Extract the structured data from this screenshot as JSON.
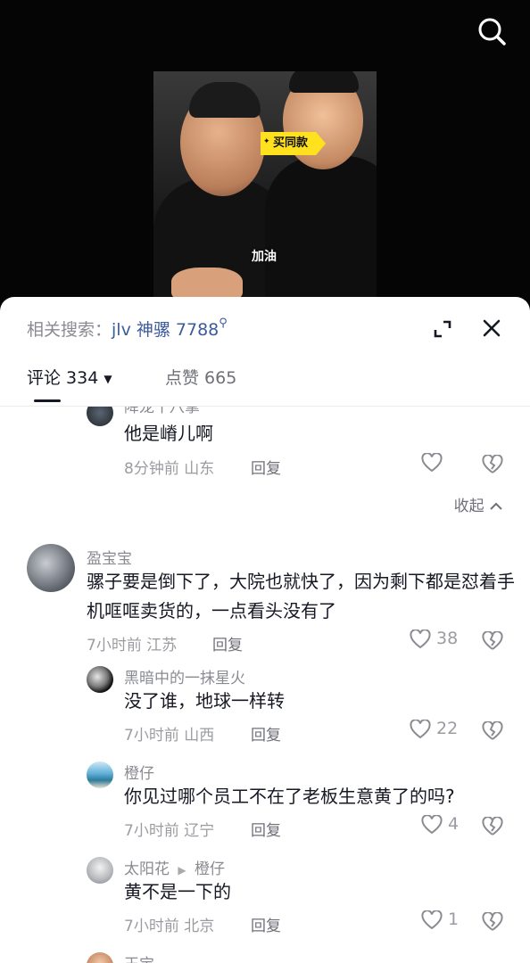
{
  "video": {
    "tag_label": "买同款",
    "caption": "加油"
  },
  "sheet": {
    "related_prefix": "相关搜索：",
    "related_keyword": "jlv 神骡 7788",
    "tabs": {
      "comments": "评论 334",
      "likes": "点赞 665"
    }
  },
  "comments": [
    {
      "username": "降龙十八掌",
      "text": "他是嵴儿啊",
      "time": "8分钟前",
      "location": "山东",
      "reply_label": "回复",
      "likes": ""
    },
    {
      "collapse_label": "收起"
    },
    {
      "username": "盈宝宝",
      "text": "骡子要是倒下了，大院也就快了，因为剩下都是怼着手机哐哐卖货的，一点看头没有了",
      "time": "7小时前",
      "location": "江苏",
      "reply_label": "回复",
      "likes": "38"
    },
    {
      "username": "黑暗中的一抹星火",
      "text": "没了谁，地球一样转",
      "time": "7小时前",
      "location": "山西",
      "reply_label": "回复",
      "likes": "22"
    },
    {
      "username": "橙仔",
      "text": "你见过哪个员工不在了老板生意黄了的吗?",
      "time": "7小时前",
      "location": "辽宁",
      "reply_label": "回复",
      "likes": "4"
    },
    {
      "username": "太阳花",
      "reply_to": "橙仔",
      "text": "黄不是一下的",
      "time": "7小时前",
      "location": "北京",
      "reply_label": "回复",
      "likes": "1"
    },
    {
      "username": "王宝"
    }
  ],
  "icons": {
    "search": "search-icon",
    "expand": "expand-icon",
    "close": "close-icon",
    "like": "heart-icon",
    "dislike": "broken-heart-icon",
    "dropdown": "caret-down-icon",
    "collapse": "chevron-up-icon"
  }
}
